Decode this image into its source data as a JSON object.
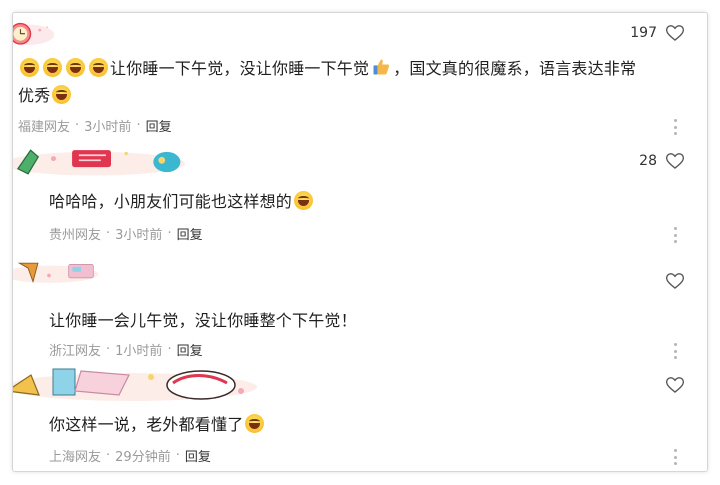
{
  "comments": [
    {
      "likes": "197",
      "text_before": "让你睡一下午觉，没让你睡一下午觉",
      "text_after": "，国文真的很魔系，语言表达非常",
      "text_line2": "优秀",
      "location": "福建网友",
      "time": "3小时前",
      "reply_label": "回复"
    },
    {
      "likes": "28",
      "text": "哈哈哈，小朋友们可能也这样想的",
      "location": "贵州网友",
      "time": "3小时前",
      "reply_label": "回复"
    },
    {
      "likes": "",
      "text": "让你睡一会儿午觉，没让你睡整个下午觉！",
      "location": "浙江网友",
      "time": "1小时前",
      "reply_label": "回复"
    },
    {
      "likes": "",
      "text": "你这样一说，老外都看懂了",
      "location": "上海网友",
      "time": "29分钟前",
      "reply_label": "回复"
    }
  ],
  "separator": "·",
  "icons": {
    "like": "heart-outline-icon",
    "more": "vertical-dots-icon",
    "emoji": "grinning-face-emoji-icon",
    "thumb": "thumbs-up-emoji-icon"
  },
  "colors": {
    "meta_text": "#9a9a9a",
    "reply_text": "#333333",
    "heart_stroke": "#555555",
    "banner_pink": "#f7a8b8",
    "banner_red": "#e0364f",
    "banner_yellow": "#f8d56b"
  }
}
